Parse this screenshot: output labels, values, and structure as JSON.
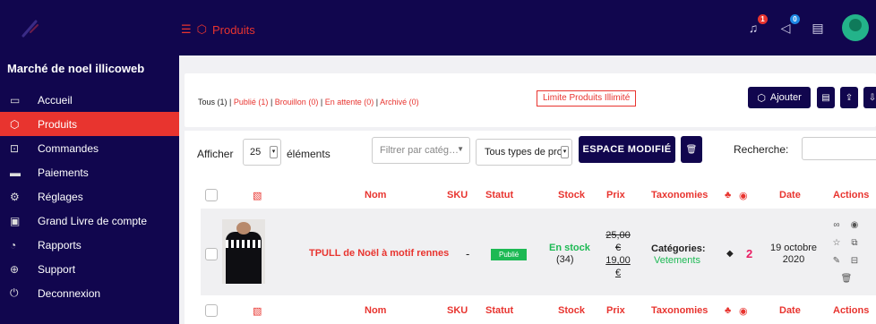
{
  "header": {
    "crumb": "Produits",
    "badges": {
      "notifications": "1",
      "messages": "0"
    },
    "icons": [
      "menu-icon",
      "box-icon",
      "bell-icon",
      "megaphone-icon",
      "document-icon",
      "avatar"
    ]
  },
  "sidebar": {
    "shop_name": "Marché de noel illicoweb",
    "items": [
      {
        "label": "Accueil",
        "icon": "laptop-icon"
      },
      {
        "label": "Produits",
        "icon": "box-icon",
        "active": true
      },
      {
        "label": "Commandes",
        "icon": "cart-icon"
      },
      {
        "label": "Paiements",
        "icon": "card-icon"
      },
      {
        "label": "Réglages",
        "icon": "gears-icon"
      },
      {
        "label": "Grand Livre de compte",
        "icon": "cash-icon"
      },
      {
        "label": "Rapports",
        "icon": "chart-icon"
      },
      {
        "label": "Support",
        "icon": "lifebuoy-icon"
      },
      {
        "label": "Deconnexion",
        "icon": "power-icon"
      }
    ]
  },
  "status_filters": {
    "all": "Tous (1)",
    "sep": "|",
    "published": "Publié (1)",
    "draft": "Brouillon (0)",
    "pending": "En attente (0)",
    "archived": "Archivé (0)"
  },
  "limit_label": "Limite Produits Illimité",
  "add_label": "Ajouter",
  "table_controls": {
    "show_label": "Afficher",
    "page_size": "25",
    "elements_label": "éléments",
    "category_placeholder": "Filtrer par catég…",
    "types_value": "Tous types de prod",
    "espace_label": "ESPACE MODIFIÉ",
    "search_label": "Recherche:"
  },
  "columns": {
    "name": "Nom",
    "sku": "SKU",
    "status": "Statut",
    "stock": "Stock",
    "price": "Prix",
    "taxonomies": "Taxonomies",
    "date": "Date",
    "actions": "Actions"
  },
  "product": {
    "name": "TPULL de Noël à motif rennes",
    "sku": "-",
    "status": "Publié",
    "stock_status": "En stock",
    "stock_qty": "(34)",
    "price_old_1": "25,00",
    "price_old_2": "€",
    "price_new_1": "19,00",
    "price_new_2": "€",
    "category_label": "Catégories:",
    "category_value": "Vetements",
    "views": "2",
    "date_1": "19 octobre",
    "date_2": "2020"
  },
  "colors": {
    "navy": "#11064e",
    "accent": "#e8342f",
    "green": "#1db954",
    "pink": "#e91e63"
  }
}
